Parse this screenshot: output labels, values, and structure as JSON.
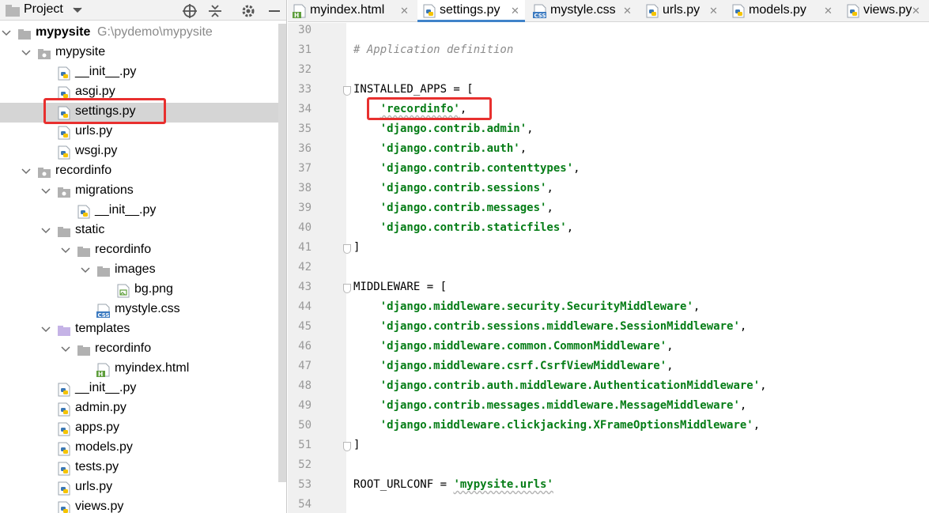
{
  "project_panel": {
    "title": "Project",
    "tree": [
      {
        "label": "mypysite",
        "path": "G:\\pydemo\\mypysite",
        "type": "folder",
        "level": 0,
        "expanded": true,
        "bold": true
      },
      {
        "label": "mypysite",
        "type": "package",
        "level": 1,
        "expanded": true
      },
      {
        "label": "__init__.py",
        "type": "py",
        "level": 2
      },
      {
        "label": "asgi.py",
        "type": "py",
        "level": 2
      },
      {
        "label": "settings.py",
        "type": "py",
        "level": 2,
        "selected": true
      },
      {
        "label": "urls.py",
        "type": "py",
        "level": 2
      },
      {
        "label": "wsgi.py",
        "type": "py",
        "level": 2
      },
      {
        "label": "recordinfo",
        "type": "package",
        "level": 1,
        "expanded": true
      },
      {
        "label": "migrations",
        "type": "package",
        "level": 2,
        "expanded": true
      },
      {
        "label": "__init__.py",
        "type": "py",
        "level": 3
      },
      {
        "label": "static",
        "type": "folder",
        "level": 2,
        "expanded": true
      },
      {
        "label": "recordinfo",
        "type": "folder",
        "level": 3,
        "expanded": true
      },
      {
        "label": "images",
        "type": "folder",
        "level": 4,
        "expanded": true
      },
      {
        "label": "bg.png",
        "type": "png",
        "level": 5
      },
      {
        "label": "mystyle.css",
        "type": "css",
        "level": 4
      },
      {
        "label": "templates",
        "type": "template-folder",
        "level": 2,
        "expanded": true
      },
      {
        "label": "recordinfo",
        "type": "folder",
        "level": 3,
        "expanded": true
      },
      {
        "label": "myindex.html",
        "type": "html",
        "level": 4
      },
      {
        "label": "__init__.py",
        "type": "py",
        "level": 2
      },
      {
        "label": "admin.py",
        "type": "py",
        "level": 2
      },
      {
        "label": "apps.py",
        "type": "py",
        "level": 2
      },
      {
        "label": "models.py",
        "type": "py",
        "level": 2
      },
      {
        "label": "tests.py",
        "type": "py",
        "level": 2
      },
      {
        "label": "urls.py",
        "type": "py",
        "level": 2
      },
      {
        "label": "views.py",
        "type": "py",
        "level": 2
      }
    ]
  },
  "tabs": [
    {
      "label": "myindex.html",
      "type": "html",
      "active": false
    },
    {
      "label": "settings.py",
      "type": "py",
      "active": true
    },
    {
      "label": "mystyle.css",
      "type": "css",
      "active": false
    },
    {
      "label": "urls.py",
      "type": "py",
      "active": false
    },
    {
      "label": "models.py",
      "type": "py",
      "active": false
    },
    {
      "label": "views.py",
      "type": "py",
      "active": false
    }
  ],
  "editor": {
    "lines": [
      {
        "n": "30",
        "t": ""
      },
      {
        "n": "31",
        "t": "# Application definition",
        "k": "comment"
      },
      {
        "n": "32",
        "t": ""
      },
      {
        "n": "33",
        "t": "INSTALLED_APPS = [",
        "fold": true
      },
      {
        "n": "34",
        "t": "    'recordinfo',",
        "k": "str"
      },
      {
        "n": "35",
        "t": "    'django.contrib.admin',",
        "k": "str"
      },
      {
        "n": "36",
        "t": "    'django.contrib.auth',",
        "k": "str"
      },
      {
        "n": "37",
        "t": "    'django.contrib.contenttypes',",
        "k": "str"
      },
      {
        "n": "38",
        "t": "    'django.contrib.sessions',",
        "k": "str"
      },
      {
        "n": "39",
        "t": "    'django.contrib.messages',",
        "k": "str"
      },
      {
        "n": "40",
        "t": "    'django.contrib.staticfiles',",
        "k": "str"
      },
      {
        "n": "41",
        "t": "]",
        "fold": true
      },
      {
        "n": "42",
        "t": ""
      },
      {
        "n": "43",
        "t": "MIDDLEWARE = [",
        "fold": true
      },
      {
        "n": "44",
        "t": "    'django.middleware.security.SecurityMiddleware',",
        "k": "str"
      },
      {
        "n": "45",
        "t": "    'django.contrib.sessions.middleware.SessionMiddleware',",
        "k": "str"
      },
      {
        "n": "46",
        "t": "    'django.middleware.common.CommonMiddleware',",
        "k": "str"
      },
      {
        "n": "47",
        "t": "    'django.middleware.csrf.CsrfViewMiddleware',",
        "k": "str"
      },
      {
        "n": "48",
        "t": "    'django.contrib.auth.middleware.AuthenticationMiddleware',",
        "k": "str"
      },
      {
        "n": "49",
        "t": "    'django.contrib.messages.middleware.MessageMiddleware',",
        "k": "str"
      },
      {
        "n": "50",
        "t": "    'django.middleware.clickjacking.XFrameOptionsMiddleware',",
        "k": "str"
      },
      {
        "n": "51",
        "t": "]",
        "fold": true
      },
      {
        "n": "52",
        "t": ""
      },
      {
        "n": "53",
        "t": "ROOT_URLCONF = 'mypysite.urls'",
        "k": "assign"
      },
      {
        "n": "54",
        "t": ""
      }
    ]
  },
  "colors": {
    "string": "#067d17",
    "comment": "#8c8c8c",
    "annotation": "#e8302f",
    "selection": "#d5d5d5",
    "tab_underline": "#4083c9"
  }
}
